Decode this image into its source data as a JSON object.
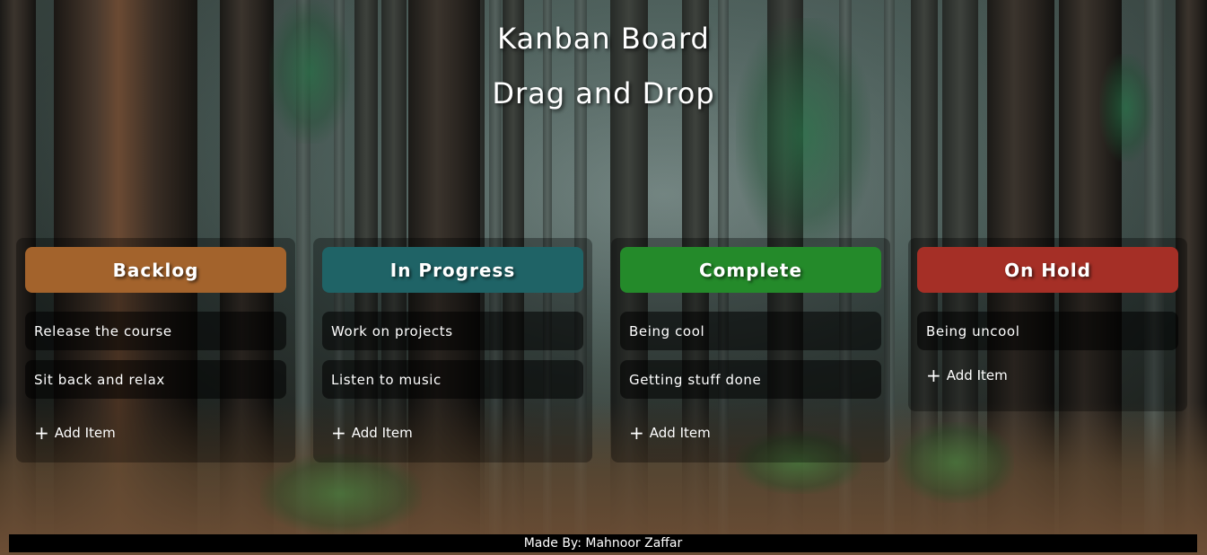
{
  "header": {
    "title": "Kanban Board",
    "subtitle": "Drag and Drop"
  },
  "columns": [
    {
      "title": "Backlog",
      "color": "#a3632c",
      "items": [
        "Release the course",
        "Sit back and relax"
      ],
      "add_label": "Add Item"
    },
    {
      "title": "In Progress",
      "color": "#1f6366",
      "items": [
        "Work on projects",
        "Listen to music"
      ],
      "add_label": "Add Item"
    },
    {
      "title": "Complete",
      "color": "#248a2a",
      "items": [
        "Being cool",
        "Getting stuff done"
      ],
      "add_label": "Add Item"
    },
    {
      "title": "On Hold",
      "color": "#a52f26",
      "items": [
        "Being uncool"
      ],
      "add_label": "Add Item"
    }
  ],
  "footer": {
    "text": "Made By: Mahnoor Zaffar"
  }
}
